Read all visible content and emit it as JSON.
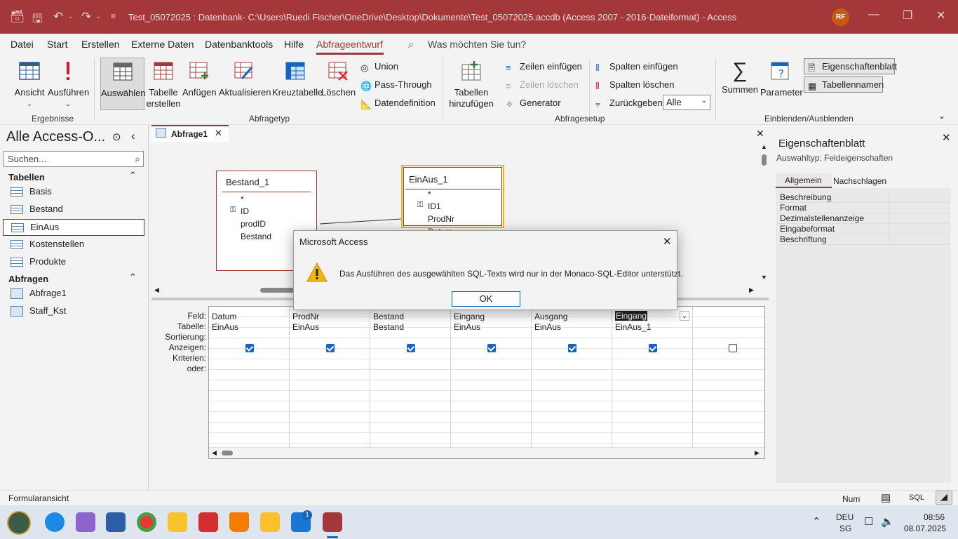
{
  "window": {
    "title": "Test_05072025 : Datenbank- C:\\Users\\Ruedi Fischer\\OneDrive\\Desktop\\Dokumente\\Test_05072025.accdb (Access 2007 - 2016-Dateiformat)  -  Access",
    "avatar_initials": "RF"
  },
  "menu": {
    "tabs": [
      "Datei",
      "Start",
      "Erstellen",
      "Externe Daten",
      "Datenbanktools",
      "Hilfe",
      "Abfrageentwurf"
    ],
    "active_tab": "Abfrageentwurf",
    "search_placeholder": "Was möchten Sie tun?"
  },
  "ribbon": {
    "ergebnisse": {
      "label": "Ergebnisse",
      "ansicht": "Ansicht",
      "ausfuehren": "Ausführen"
    },
    "abfragetyp": {
      "label": "Abfragetyp",
      "auswaehlen": "Auswählen",
      "tabelle_erstellen_1": "Tabelle",
      "tabelle_erstellen_2": "erstellen",
      "anfuegen": "Anfügen",
      "aktualisieren": "Aktualisieren",
      "kreuztabelle": "Kreuztabelle",
      "loeschen": "Löschen",
      "union": "Union",
      "pass_through": "Pass-Through",
      "datendefinition": "Datendefinition"
    },
    "abfragesetup": {
      "label": "Abfragesetup",
      "tabellen_hinzufuegen_1": "Tabellen",
      "tabellen_hinzufuegen_2": "hinzufügen",
      "zeilen_einfuegen": "Zeilen einfügen",
      "zeilen_loeschen": "Zeilen löschen",
      "generator": "Generator",
      "spalten_einfuegen": "Spalten einfügen",
      "spalten_loeschen": "Spalten löschen",
      "zurueckgeben": "Zurückgeben:",
      "zurueckgeben_value": "Alle"
    },
    "einblenden": {
      "label": "Einblenden/Ausblenden",
      "summen": "Summen",
      "parameter": "Parameter",
      "eigenschaftenblatt": "Eigenschaftenblatt",
      "tabellennamen": "Tabellennamen"
    }
  },
  "nav": {
    "title": "Alle Access-O...",
    "search_placeholder": "Suchen...",
    "tables_header": "Tabellen",
    "tables": [
      "Basis",
      "Bestand",
      "EinAus",
      "Kostenstellen",
      "Produkte"
    ],
    "selected_table": "EinAus",
    "queries_header": "Abfragen",
    "queries": [
      "Abfrage1",
      "Staff_Kst"
    ]
  },
  "document": {
    "tab_label": "Abfrage1",
    "tables": [
      {
        "name": "Bestand_1",
        "fields": [
          "*",
          "ID",
          "prodID",
          "Bestand"
        ]
      },
      {
        "name": "EinAus_1",
        "fields": [
          "*",
          "ID1",
          "ProdNr",
          "Datum"
        ]
      }
    ]
  },
  "grid": {
    "row_labels": [
      "Feld:",
      "Tabelle:",
      "Sortierung:",
      "Anzeigen:",
      "Kriterien:",
      "oder:"
    ],
    "columns": [
      {
        "field": "Datum",
        "table": "EinAus",
        "show": true
      },
      {
        "field": "ProdNr",
        "table": "EinAus",
        "show": true
      },
      {
        "field": "Bestand",
        "table": "Bestand",
        "show": true
      },
      {
        "field": "Eingang",
        "table": "EinAus",
        "show": true
      },
      {
        "field": "Ausgang",
        "table": "EinAus",
        "show": true
      },
      {
        "field": "Eingang",
        "table": "EinAus_1",
        "show": true
      },
      {
        "field": "",
        "table": "",
        "show": false
      }
    ]
  },
  "properties": {
    "title": "Eigenschaftenblatt",
    "selection_type": "Auswahltyp:  Feldeigenschaften",
    "tabs": [
      "Allgemein",
      "Nachschlagen"
    ],
    "rows": [
      "Beschreibung",
      "Format",
      "Dezimalstellenanzeige",
      "Eingabeformat",
      "Beschriftung"
    ]
  },
  "dialog": {
    "title": "Microsoft Access",
    "message": "Das Ausführen des ausgewählten SQL-Texts wird nur in der Monaco-SQL-Editor unterstützt.",
    "ok": "OK"
  },
  "status": {
    "left": "Formularansicht",
    "num": "Num",
    "sql": "SQL"
  },
  "taskbar": {
    "lang": "DEU",
    "region": "SG",
    "time": "08:56",
    "date": "08.07.2025",
    "badge": "1"
  },
  "colors": {
    "accent": "#a4373a",
    "checkbox": "#1565c0",
    "warning": "#f2b600"
  }
}
